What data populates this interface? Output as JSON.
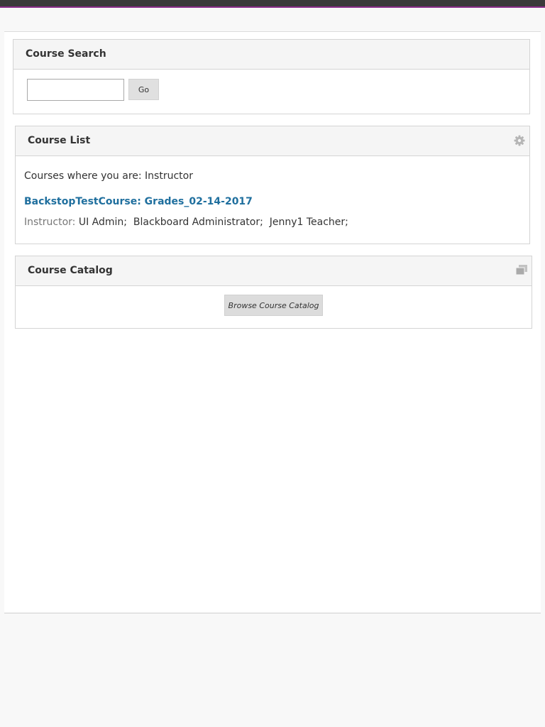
{
  "colors": {
    "topbar": "#3a3a3a",
    "accent_line": "#8a2d8a",
    "link": "#1f6f9e"
  },
  "course_search": {
    "title": "Course Search",
    "input_value": "",
    "go_label": "Go"
  },
  "course_list": {
    "title": "Course List",
    "settings_icon": "gear-icon",
    "role_text": "Courses where you are: Instructor",
    "courses": [
      {
        "name": "BackstopTestCourse: Grades_02-14-2017",
        "instructor_label": "Instructor:",
        "instructors": " UI Admin;  Blackboard Administrator;  Jenny1 Teacher;"
      }
    ]
  },
  "course_catalog": {
    "title": "Course Catalog",
    "icon": "windows-icon",
    "browse_label": "Browse Course Catalog"
  }
}
